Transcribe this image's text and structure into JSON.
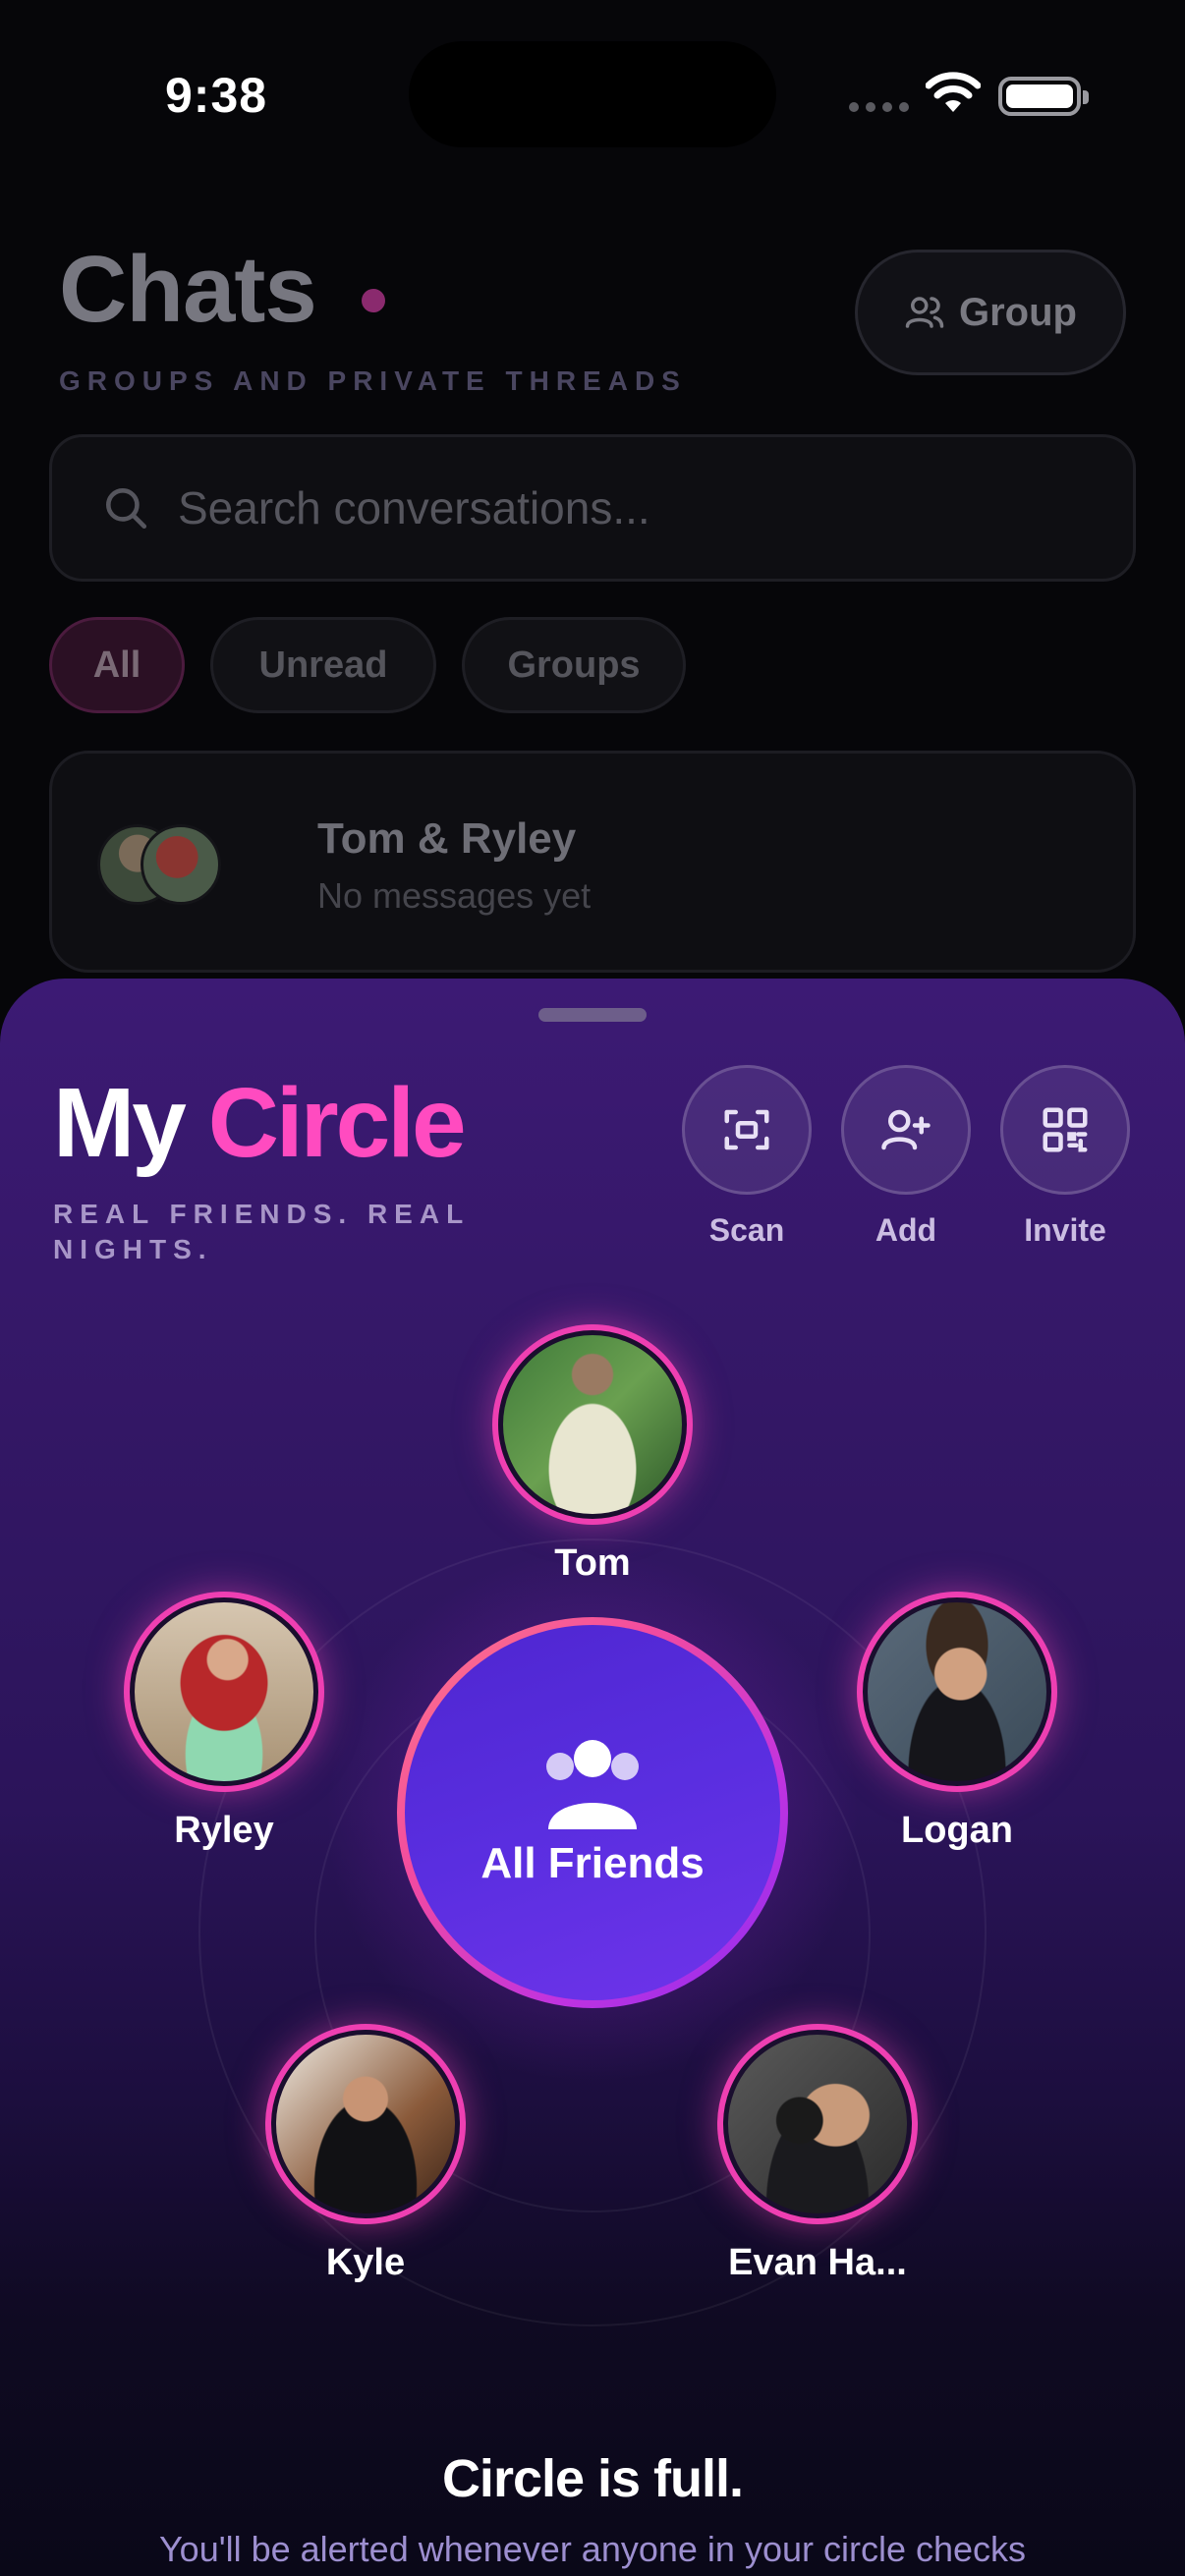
{
  "status": {
    "time": "9:38"
  },
  "chats": {
    "title": "Chats",
    "subtitle": "GROUPS AND PRIVATE THREADS",
    "group_button": "Group",
    "search_placeholder": "Search conversations...",
    "filters": [
      "All",
      "Unread",
      "Groups"
    ],
    "conversation": {
      "name": "Tom & Ryley",
      "preview": "No messages yet"
    }
  },
  "circle": {
    "title_part1": "My",
    "title_part2": "Circle",
    "subtitle": "REAL FRIENDS. REAL NIGHTS.",
    "actions": [
      {
        "label": "Scan",
        "icon": "scan-icon"
      },
      {
        "label": "Add",
        "icon": "add-person-icon"
      },
      {
        "label": "Invite",
        "icon": "qr-code-icon"
      }
    ],
    "center_label": "All Friends",
    "friends": [
      {
        "name": "Tom"
      },
      {
        "name": "Ryley"
      },
      {
        "name": "Logan"
      },
      {
        "name": "Kyle"
      },
      {
        "name": "Evan Ha..."
      }
    ],
    "full_title": "Circle is full.",
    "full_subtitle": "You'll be alerted whenever anyone in your circle checks"
  },
  "colors": {
    "accent_pink": "#ff4bc0",
    "center_purple": "#5a2ee0"
  }
}
